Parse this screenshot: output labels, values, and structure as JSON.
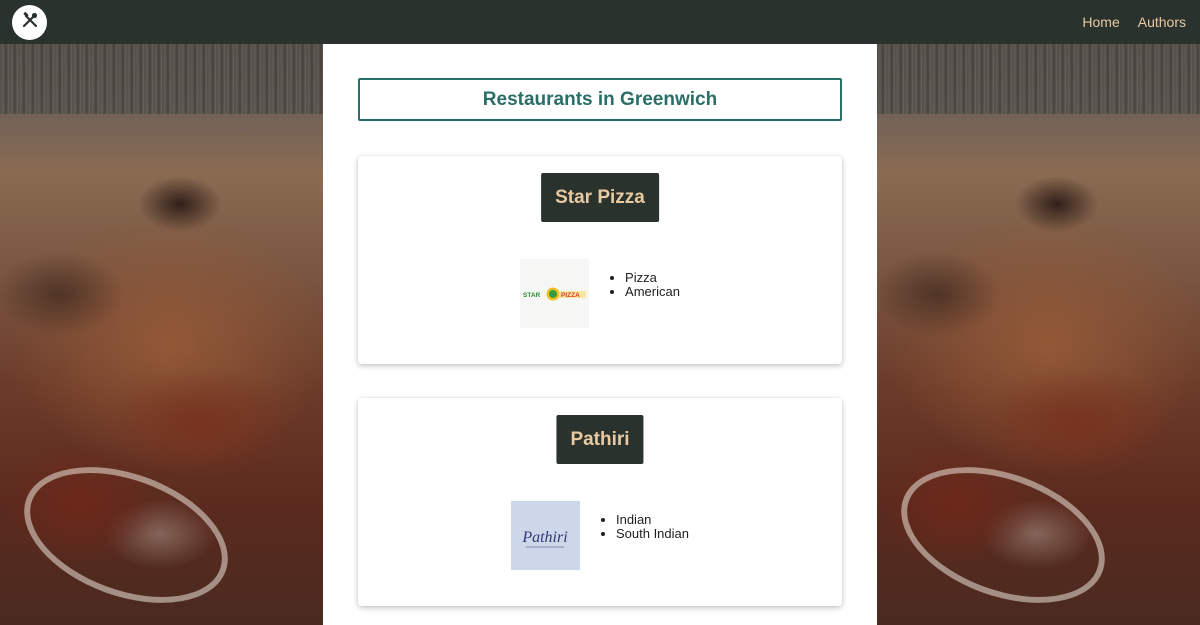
{
  "nav": {
    "logo_icon": "utensils-icon",
    "links": [
      {
        "label": "Home"
      },
      {
        "label": "Authors"
      }
    ]
  },
  "page": {
    "title": "Restaurants in Greenwich"
  },
  "restaurants": [
    {
      "name": "Star Pizza",
      "logo_text_left": "STAR",
      "logo_text_right": "PIZZA",
      "cuisines": [
        "Pizza",
        "American"
      ]
    },
    {
      "name": "Pathiri",
      "logo_text": "Pathiri",
      "cuisines": [
        "Indian",
        "South Indian"
      ]
    }
  ],
  "colors": {
    "navbar_bg": "#2a322e",
    "accent_text": "#e8c9a0",
    "title_teal": "#2b6e68"
  }
}
